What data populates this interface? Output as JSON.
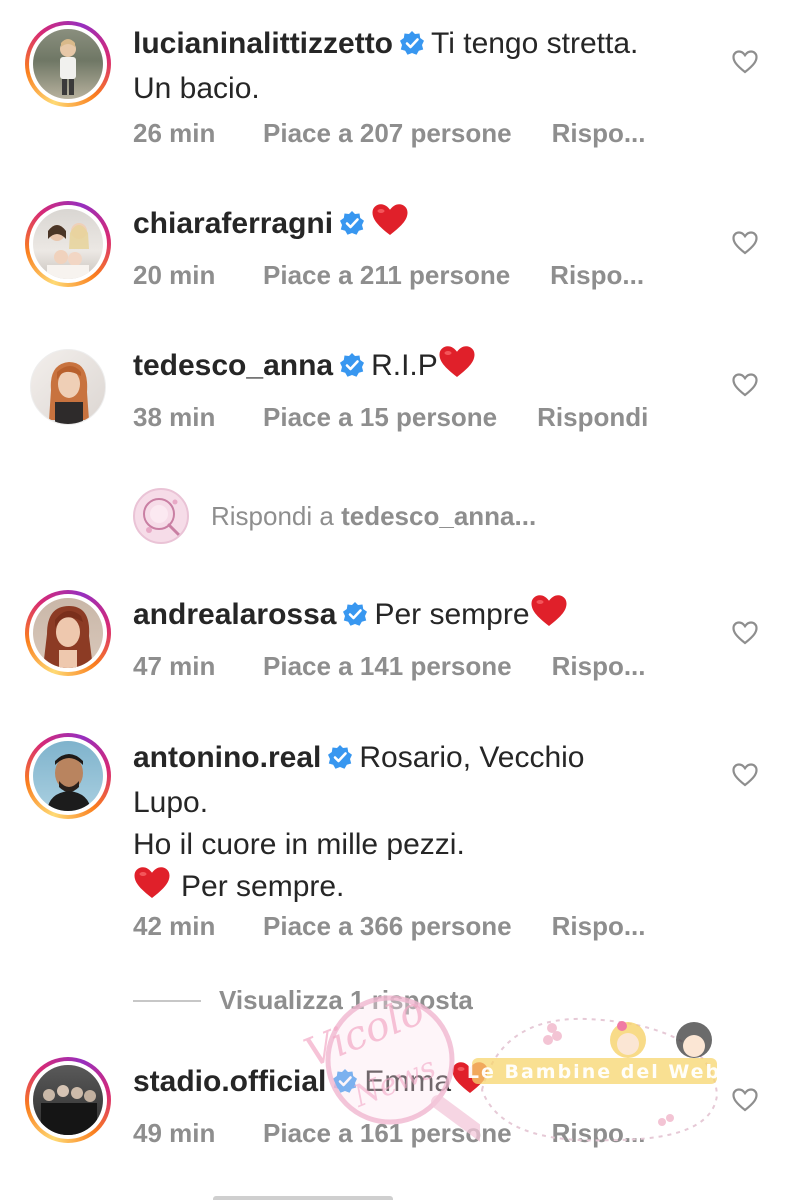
{
  "comments": [
    {
      "username": "lucianinalittizzetto",
      "text_lines": [
        "Ti tengo stretta.",
        "Un bacio."
      ],
      "time": "26 min",
      "likes": "Piace a 207 persone",
      "reply": "Rispo..."
    },
    {
      "username": "chiaraferragni",
      "text_lines": [
        ""
      ],
      "time": "20 min",
      "likes": "Piace a 211 persone",
      "reply": "Rispo..."
    },
    {
      "username": "tedesco_anna",
      "text_lines": [
        "R.I.P"
      ],
      "time": "38 min",
      "likes": "Piace a 15 persone",
      "reply": "Rispondi"
    },
    {
      "username": "andrealarossa",
      "text_lines": [
        "Per sempre"
      ],
      "time": "47 min",
      "likes": "Piace a 141 persone",
      "reply": "Rispo..."
    },
    {
      "username": "antonino.real",
      "text_lines": [
        "Rosario, Vecchio",
        "Lupo.",
        "Ho il cuore in mille pezzi.",
        "Per sempre."
      ],
      "time": "42 min",
      "likes": "Piace a 366 persone",
      "reply": "Rispo..."
    },
    {
      "username": "stadio.official",
      "text_lines": [
        "Emma"
      ],
      "time": "49 min",
      "likes": "Piace a 161 persone",
      "reply": "Rispo..."
    }
  ],
  "reply_prompt": {
    "prefix": "Rispondi a",
    "username": "tedesco_anna..."
  },
  "view_replies": "Visualizza 1 risposta",
  "icons": {
    "verified": "verified-badge-icon",
    "like": "heart-outline-icon",
    "emoji": "red-heart-emoji"
  },
  "colors": {
    "verified_blue": "#3897f0",
    "heart_red": "#e0202a",
    "meta_gray": "#8e8e8e",
    "text": "#262626"
  },
  "watermarks": {
    "left_script": "Vicolo delle News",
    "right_banner": "Le Bambine del Web"
  }
}
